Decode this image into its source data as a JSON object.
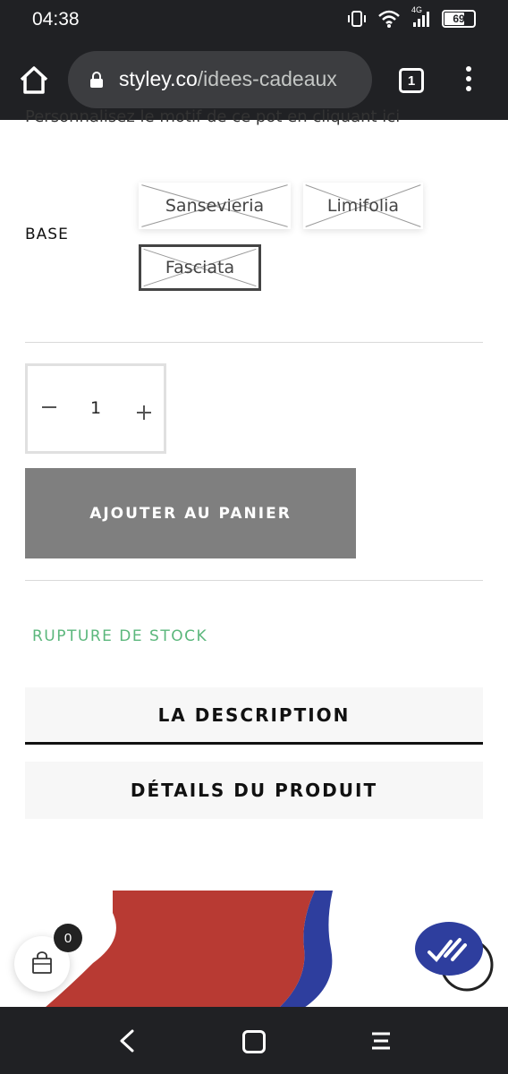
{
  "status_bar": {
    "time": "04:38",
    "network": "4G",
    "battery": "69"
  },
  "browser": {
    "url_host": "styley.co",
    "url_path": "/idees-cadeaux",
    "tab_count": "1"
  },
  "product": {
    "cutoff_text": "Personnalisez le motif de ce pot en cliquant ici",
    "base_label": "BASE",
    "variants": [
      {
        "label": "Sansevieria",
        "available": false,
        "selected": false
      },
      {
        "label": "Limifolia",
        "available": false,
        "selected": false
      },
      {
        "label": "Fasciata",
        "available": false,
        "selected": true
      }
    ],
    "quantity": "1",
    "add_to_cart_label": "AJOUTER AU PANIER",
    "stock_status": "RUPTURE DE STOCK",
    "tabs": [
      {
        "label": "LA DESCRIPTION"
      },
      {
        "label": "DÉTAILS DU PRODUIT"
      }
    ]
  },
  "cart": {
    "count": "0"
  },
  "colors": {
    "accent_green": "#5bb77c",
    "button_gray": "#7f7f7f",
    "chat_blue": "#2e3e9e",
    "art_red": "#b83a33"
  }
}
